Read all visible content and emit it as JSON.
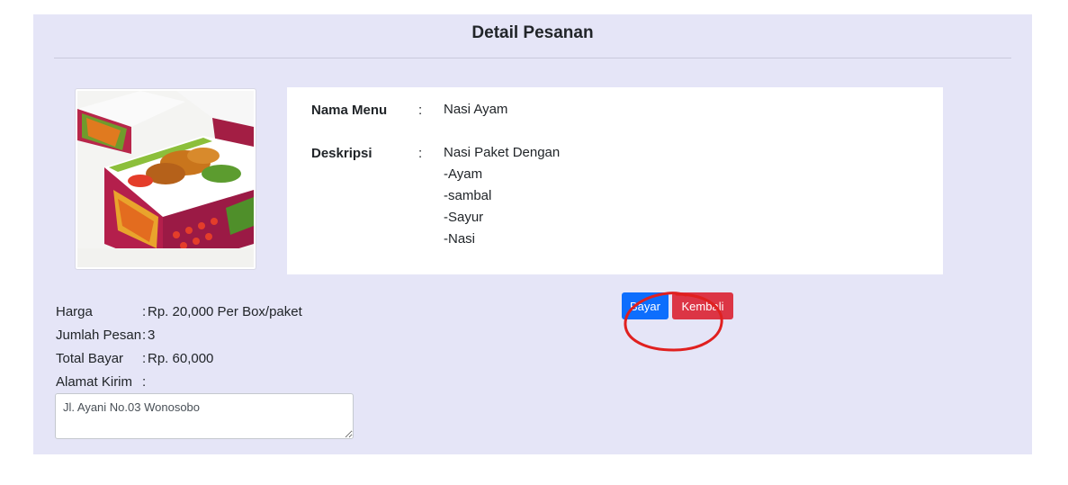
{
  "page": {
    "title": "Detail Pesanan"
  },
  "product": {
    "image_icon": "food-box-photo",
    "name_label": "Nama Menu",
    "name_colon": ":",
    "name_value": "Nasi Ayam",
    "desc_label": "Deskripsi",
    "desc_colon": ":",
    "desc_lines": [
      "Nasi Paket Dengan",
      "-Ayam",
      "-sambal",
      "-Sayur",
      "-Nasi"
    ]
  },
  "actions": {
    "pay_label": "Bayar",
    "back_label": "Kembali",
    "pay_color": "#0d6efd",
    "back_color": "#dc3545",
    "annotation_color": "#e0201f"
  },
  "summary": {
    "price_label": "Harga",
    "price_colon": ":",
    "price_value": "Rp. 20,000 Per Box/paket",
    "qty_label": "Jumlah Pesan",
    "qty_colon": ":",
    "qty_value": "3",
    "total_label": "Total Bayar",
    "total_colon": ":",
    "total_value": "Rp. 60,000",
    "address_label": "Alamat Kirim",
    "address_colon": ":",
    "address_value": "Jl. Ayani No.03 Wonosobo"
  }
}
